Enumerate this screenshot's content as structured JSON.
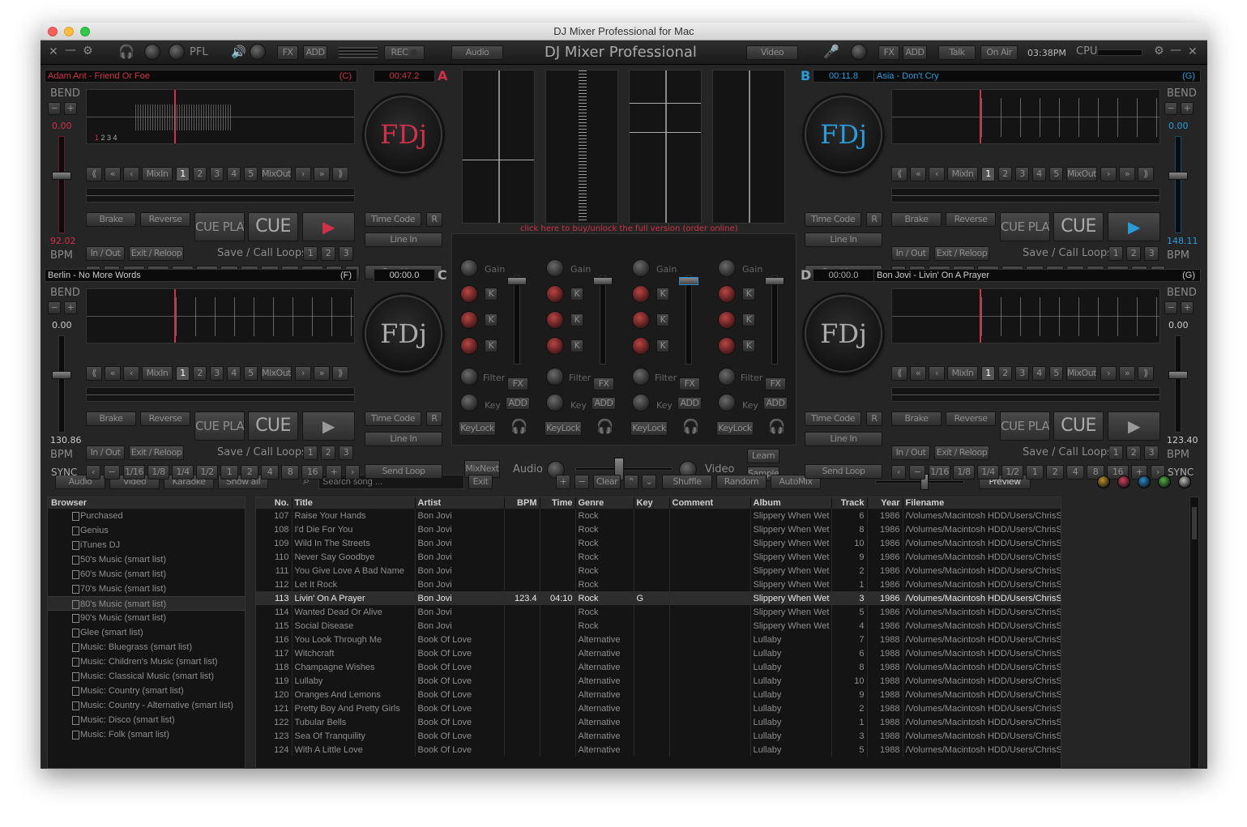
{
  "window": {
    "title": "DJ Mixer Professional for Mac"
  },
  "app_title": "DJ Mixer Professional",
  "topbar": {
    "pfl": "PFL",
    "fx": "FX",
    "add": "ADD",
    "rec": "REC",
    "audio": "Audio",
    "video": "Video",
    "fx2": "FX",
    "add2": "ADD",
    "talk": "Talk",
    "on_air": "On Air",
    "clock": "03:38PM",
    "cpu": "CPU"
  },
  "unlock_msg": "click here to buy/unlock the full version (order online)",
  "decks": {
    "A": {
      "letter": "A",
      "track": "Adam Ant - Friend Or Foe",
      "key": "(C)",
      "time": "00:47.2",
      "pitch": "0.00",
      "bpm": "92.02",
      "logo": "FDj",
      "accent": "#d0304a"
    },
    "B": {
      "letter": "B",
      "track": "Asia - Don't Cry",
      "key": "(G)",
      "time": "00:11.8",
      "pitch": "0.00",
      "bpm": "148.11",
      "logo": "FDj",
      "accent": "#2a9ad8"
    },
    "C": {
      "letter": "C",
      "track": "Berlin - No More Words",
      "key": "(F)",
      "time": "00:00.0",
      "pitch": "0.00",
      "bpm": "130.86",
      "logo": "FDj",
      "accent": "#888888"
    },
    "D": {
      "letter": "D",
      "track": "Bon Jovi - Livin' On A Prayer",
      "key": "(G)",
      "time": "00:00.0",
      "pitch": "0.00",
      "bpm": "123.40",
      "logo": "FDj",
      "accent": "#888888"
    }
  },
  "deck_labels": {
    "bend": "BEND",
    "bpm": "BPM",
    "sync": "SYNC",
    "brake": "Brake",
    "reverse": "Reverse",
    "cue_play": "CUE PLAY",
    "cue": "CUE",
    "in_out": "In / Out",
    "exit_reloop": "Exit / Reloop",
    "save_call_loops": "Save / Call Loops",
    "mixin": "MixIn",
    "mixout": "MixOut",
    "time_code": "Time Code",
    "r": "R",
    "line_in": "Line In",
    "send_loop": "Send Loop",
    "hot": [
      "1",
      "2",
      "3",
      "4",
      "5"
    ],
    "loop_slots": [
      "1",
      "2",
      "3"
    ],
    "loops": [
      "1/16",
      "1/8",
      "1/4",
      "1/2",
      "1",
      "2",
      "4",
      "8",
      "16"
    ]
  },
  "mixer": {
    "gain": "Gain",
    "filter": "Filter",
    "key": "Key",
    "fx": "FX",
    "add": "ADD",
    "keylock": "KeyLock",
    "k": "K",
    "mixnext": "MixNext",
    "audio": "Audio",
    "video": "Video",
    "learn": "Learn",
    "sampler": "Sampler"
  },
  "toolbar": {
    "audio": "Audio",
    "video": "Video",
    "karaoke": "Karaoke",
    "show_all": "Show all",
    "search_placeholder": "Search song ...",
    "exit": "Exit",
    "clear": "Clear",
    "shuffle": "Shuffle",
    "random": "Random",
    "automix": "AutoMix",
    "preview": "Preview",
    "colors": [
      "#c0902a",
      "#d04060",
      "#2a8ad0",
      "#50b040",
      "#bbbbbb"
    ]
  },
  "browser": {
    "header": "Browser",
    "items": [
      "Purchased",
      "Genius",
      "iTunes DJ",
      "50's Music (smart list)",
      "60's Music (smart list)",
      "70's Music (smart list)",
      "80's Music (smart list)",
      "90's Music (smart list)",
      "Glee (smart list)",
      "Music: Bluegrass (smart list)",
      "Music: Children's Music (smart list)",
      "Music: Classical Music (smart list)",
      "Music: Country (smart list)",
      "Music: Country - Alternative (smart list)",
      "Music: Disco (smart list)",
      "Music: Folk (smart list)"
    ]
  },
  "tracks": {
    "columns": [
      "No.",
      "Title",
      "Artist",
      "BPM",
      "Time",
      "Genre",
      "Key",
      "Comment",
      "Album",
      "Track",
      "Year",
      "Filename"
    ],
    "rows": [
      [
        "107",
        "Raise Your Hands",
        "Bon Jovi",
        "",
        "",
        "Rock",
        "",
        "",
        "Slippery When Wet",
        "6",
        "1986",
        "/Volumes/Macintosh HDD/Users/ChrisS"
      ],
      [
        "108",
        "I'd Die For You",
        "Bon Jovi",
        "",
        "",
        "Rock",
        "",
        "",
        "Slippery When Wet",
        "8",
        "1986",
        "/Volumes/Macintosh HDD/Users/ChrisS"
      ],
      [
        "109",
        "Wild In The Streets",
        "Bon Jovi",
        "",
        "",
        "Rock",
        "",
        "",
        "Slippery When Wet",
        "10",
        "1986",
        "/Volumes/Macintosh HDD/Users/ChrisS"
      ],
      [
        "110",
        "Never Say Goodbye",
        "Bon Jovi",
        "",
        "",
        "Rock",
        "",
        "",
        "Slippery When Wet",
        "9",
        "1986",
        "/Volumes/Macintosh HDD/Users/ChrisS"
      ],
      [
        "111",
        "You Give Love A Bad Name",
        "Bon Jovi",
        "",
        "",
        "Rock",
        "",
        "",
        "Slippery When Wet",
        "2",
        "1986",
        "/Volumes/Macintosh HDD/Users/ChrisS"
      ],
      [
        "112",
        "Let It Rock",
        "Bon Jovi",
        "",
        "",
        "Rock",
        "",
        "",
        "Slippery When Wet",
        "1",
        "1986",
        "/Volumes/Macintosh HDD/Users/ChrisS"
      ],
      [
        "113",
        "Livin' On A Prayer",
        "Bon Jovi",
        "123.4",
        "04:10",
        "Rock",
        "G",
        "",
        "Slippery When Wet",
        "3",
        "1986",
        "/Volumes/Macintosh HDD/Users/ChrisS"
      ],
      [
        "114",
        "Wanted Dead Or Alive",
        "Bon Jovi",
        "",
        "",
        "Rock",
        "",
        "",
        "Slippery When Wet",
        "5",
        "1986",
        "/Volumes/Macintosh HDD/Users/ChrisS"
      ],
      [
        "115",
        "Social Disease",
        "Bon Jovi",
        "",
        "",
        "Rock",
        "",
        "",
        "Slippery When Wet",
        "4",
        "1986",
        "/Volumes/Macintosh HDD/Users/ChrisS"
      ],
      [
        "116",
        "You Look Through Me",
        "Book Of Love",
        "",
        "",
        "Alternative",
        "",
        "",
        "Lullaby",
        "7",
        "1988",
        "/Volumes/Macintosh HDD/Users/ChrisS"
      ],
      [
        "117",
        "Witchcraft",
        "Book Of Love",
        "",
        "",
        "Alternative",
        "",
        "",
        "Lullaby",
        "6",
        "1988",
        "/Volumes/Macintosh HDD/Users/ChrisS"
      ],
      [
        "118",
        "Champagne Wishes",
        "Book Of Love",
        "",
        "",
        "Alternative",
        "",
        "",
        "Lullaby",
        "8",
        "1988",
        "/Volumes/Macintosh HDD/Users/ChrisS"
      ],
      [
        "119",
        "Lullaby",
        "Book Of Love",
        "",
        "",
        "Alternative",
        "",
        "",
        "Lullaby",
        "10",
        "1988",
        "/Volumes/Macintosh HDD/Users/ChrisS"
      ],
      [
        "120",
        "Oranges And Lemons",
        "Book Of Love",
        "",
        "",
        "Alternative",
        "",
        "",
        "Lullaby",
        "9",
        "1988",
        "/Volumes/Macintosh HDD/Users/ChrisS"
      ],
      [
        "121",
        "Pretty Boy And Pretty Girls",
        "Book Of Love",
        "",
        "",
        "Alternative",
        "",
        "",
        "Lullaby",
        "2",
        "1988",
        "/Volumes/Macintosh HDD/Users/ChrisS"
      ],
      [
        "122",
        "Tubular Bells",
        "Book Of Love",
        "",
        "",
        "Alternative",
        "",
        "",
        "Lullaby",
        "1",
        "1988",
        "/Volumes/Macintosh HDD/Users/ChrisS"
      ],
      [
        "123",
        "Sea Of Tranquility",
        "Book Of Love",
        "",
        "",
        "Alternative",
        "",
        "",
        "Lullaby",
        "3",
        "1988",
        "/Volumes/Macintosh HDD/Users/ChrisS"
      ],
      [
        "124",
        "With A Little Love",
        "Book Of Love",
        "",
        "",
        "Alternative",
        "",
        "",
        "Lullaby",
        "5",
        "1988",
        "/Volumes/Macintosh HDD/Users/ChrisS"
      ]
    ],
    "selected": 6
  }
}
